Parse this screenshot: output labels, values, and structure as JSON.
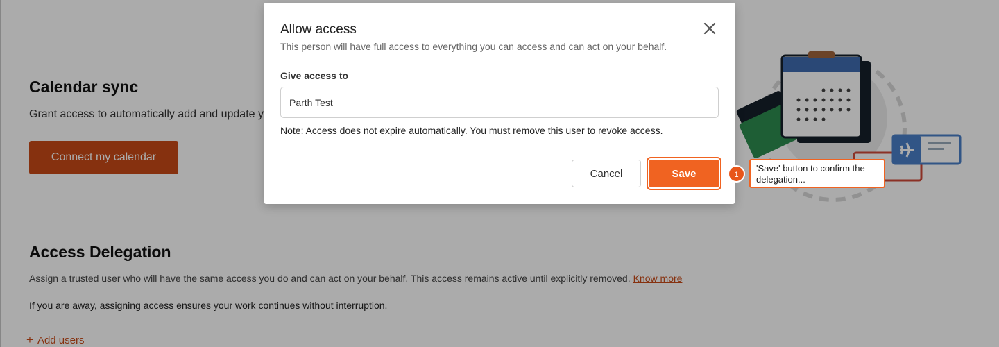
{
  "calendar_sync": {
    "title": "Calendar sync",
    "description": "Grant access to automatically add and update yo",
    "connect_button": "Connect my calendar"
  },
  "access_delegation": {
    "title": "Access Delegation",
    "description": "Assign a trusted user who will have the same access you do and can act on your behalf. This access remains active until explicitly removed.",
    "know_more": "Know more",
    "away_note": "If you are away, assigning access ensures your work continues without interruption.",
    "add_users": "Add users",
    "add_icon": "+"
  },
  "modal": {
    "title": "Allow access",
    "subtitle": "This person will have full access to everything you can access and can act on your behalf.",
    "give_access_label": "Give access to",
    "input_value": "Parth Test",
    "note": "Note: Access does not expire automatically. You must remove this user to revoke access.",
    "cancel": "Cancel",
    "save": "Save"
  },
  "callout": {
    "number": "1",
    "text": "'Save' button to confirm the delegation..."
  },
  "colors": {
    "brand": "#f06321",
    "brand_dark": "#c84a17",
    "overlay": "rgba(0,0,0,0.33)"
  },
  "icons": {
    "close": "close-icon",
    "plus": "plus-icon",
    "illustration": "calendar-travel-illustration"
  }
}
